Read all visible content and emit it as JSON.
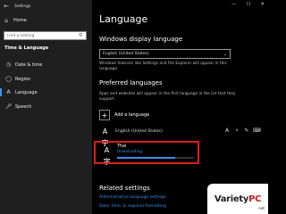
{
  "window": {
    "title": "Settings",
    "controls": [
      "—",
      "☐",
      "✕"
    ]
  },
  "sidebar": {
    "home": {
      "label": "Home",
      "icon": "home-icon"
    },
    "search": {
      "placeholder": "Find a setting",
      "icon": "search-icon"
    },
    "section": "Time & Language",
    "items": [
      {
        "label": "Date & time",
        "icon": "calendar-clock-icon",
        "active": false
      },
      {
        "label": "Region",
        "icon": "globe-icon",
        "active": false
      },
      {
        "label": "Language",
        "icon": "language-icon",
        "active": true
      },
      {
        "label": "Speech",
        "icon": "microphone-icon",
        "active": false
      }
    ]
  },
  "main": {
    "title": "Language",
    "display_language": {
      "heading": "Windows display language",
      "selected": "English (United States)",
      "description": "Windows features like Settings and File Explorer will appear in this language."
    },
    "preferred": {
      "heading": "Preferred languages",
      "description": "Apps and websites will appear in the first language in the list that they support.",
      "add_label": "Add a language",
      "languages": [
        {
          "name": "English (United States)",
          "glyph": "A字",
          "capabilities": [
            "display-icon",
            "speech-icon",
            "handwriting-icon",
            "keyboard-icon"
          ]
        },
        {
          "name": "Thai",
          "glyph": "A字",
          "status": "Downloading",
          "progress": 0.75
        }
      ]
    },
    "related": {
      "heading": "Related settings",
      "links": [
        "Administrative language settings",
        "Date, time, & regional formatting"
      ]
    }
  },
  "watermark": {
    "main": "Variety",
    "accent": "PC",
    "suffix": ".net"
  },
  "colors": {
    "accent": "#3b8eea",
    "highlight": "#e01a1a",
    "sidebar": "#1f1f1f",
    "background": "#000000"
  }
}
